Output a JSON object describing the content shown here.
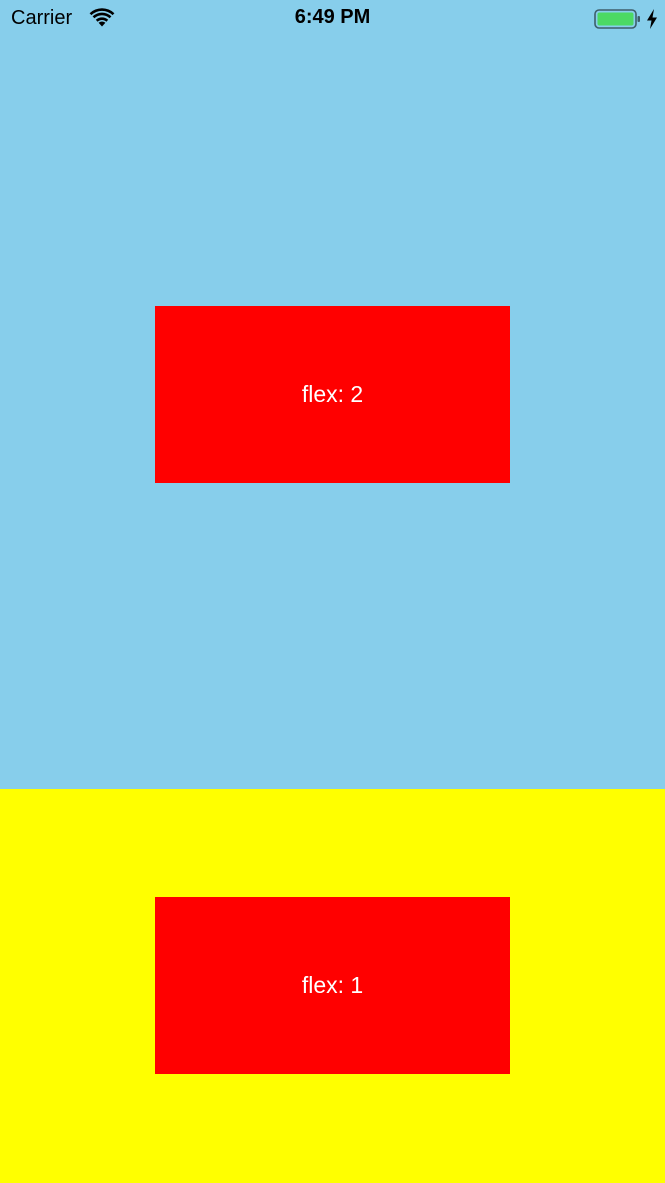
{
  "status_bar": {
    "carrier": "Carrier",
    "time": "6:49 PM",
    "wifi_icon": "wifi-icon",
    "battery_icon": "battery-icon",
    "charging_icon": "charging-bolt-icon",
    "battery_color": "#4CD964"
  },
  "panels": [
    {
      "background": "#87CEEB",
      "box_color": "#FF0000",
      "label": "flex: 2"
    },
    {
      "background": "#FFFF00",
      "box_color": "#FF0000",
      "label": "flex: 1"
    }
  ]
}
